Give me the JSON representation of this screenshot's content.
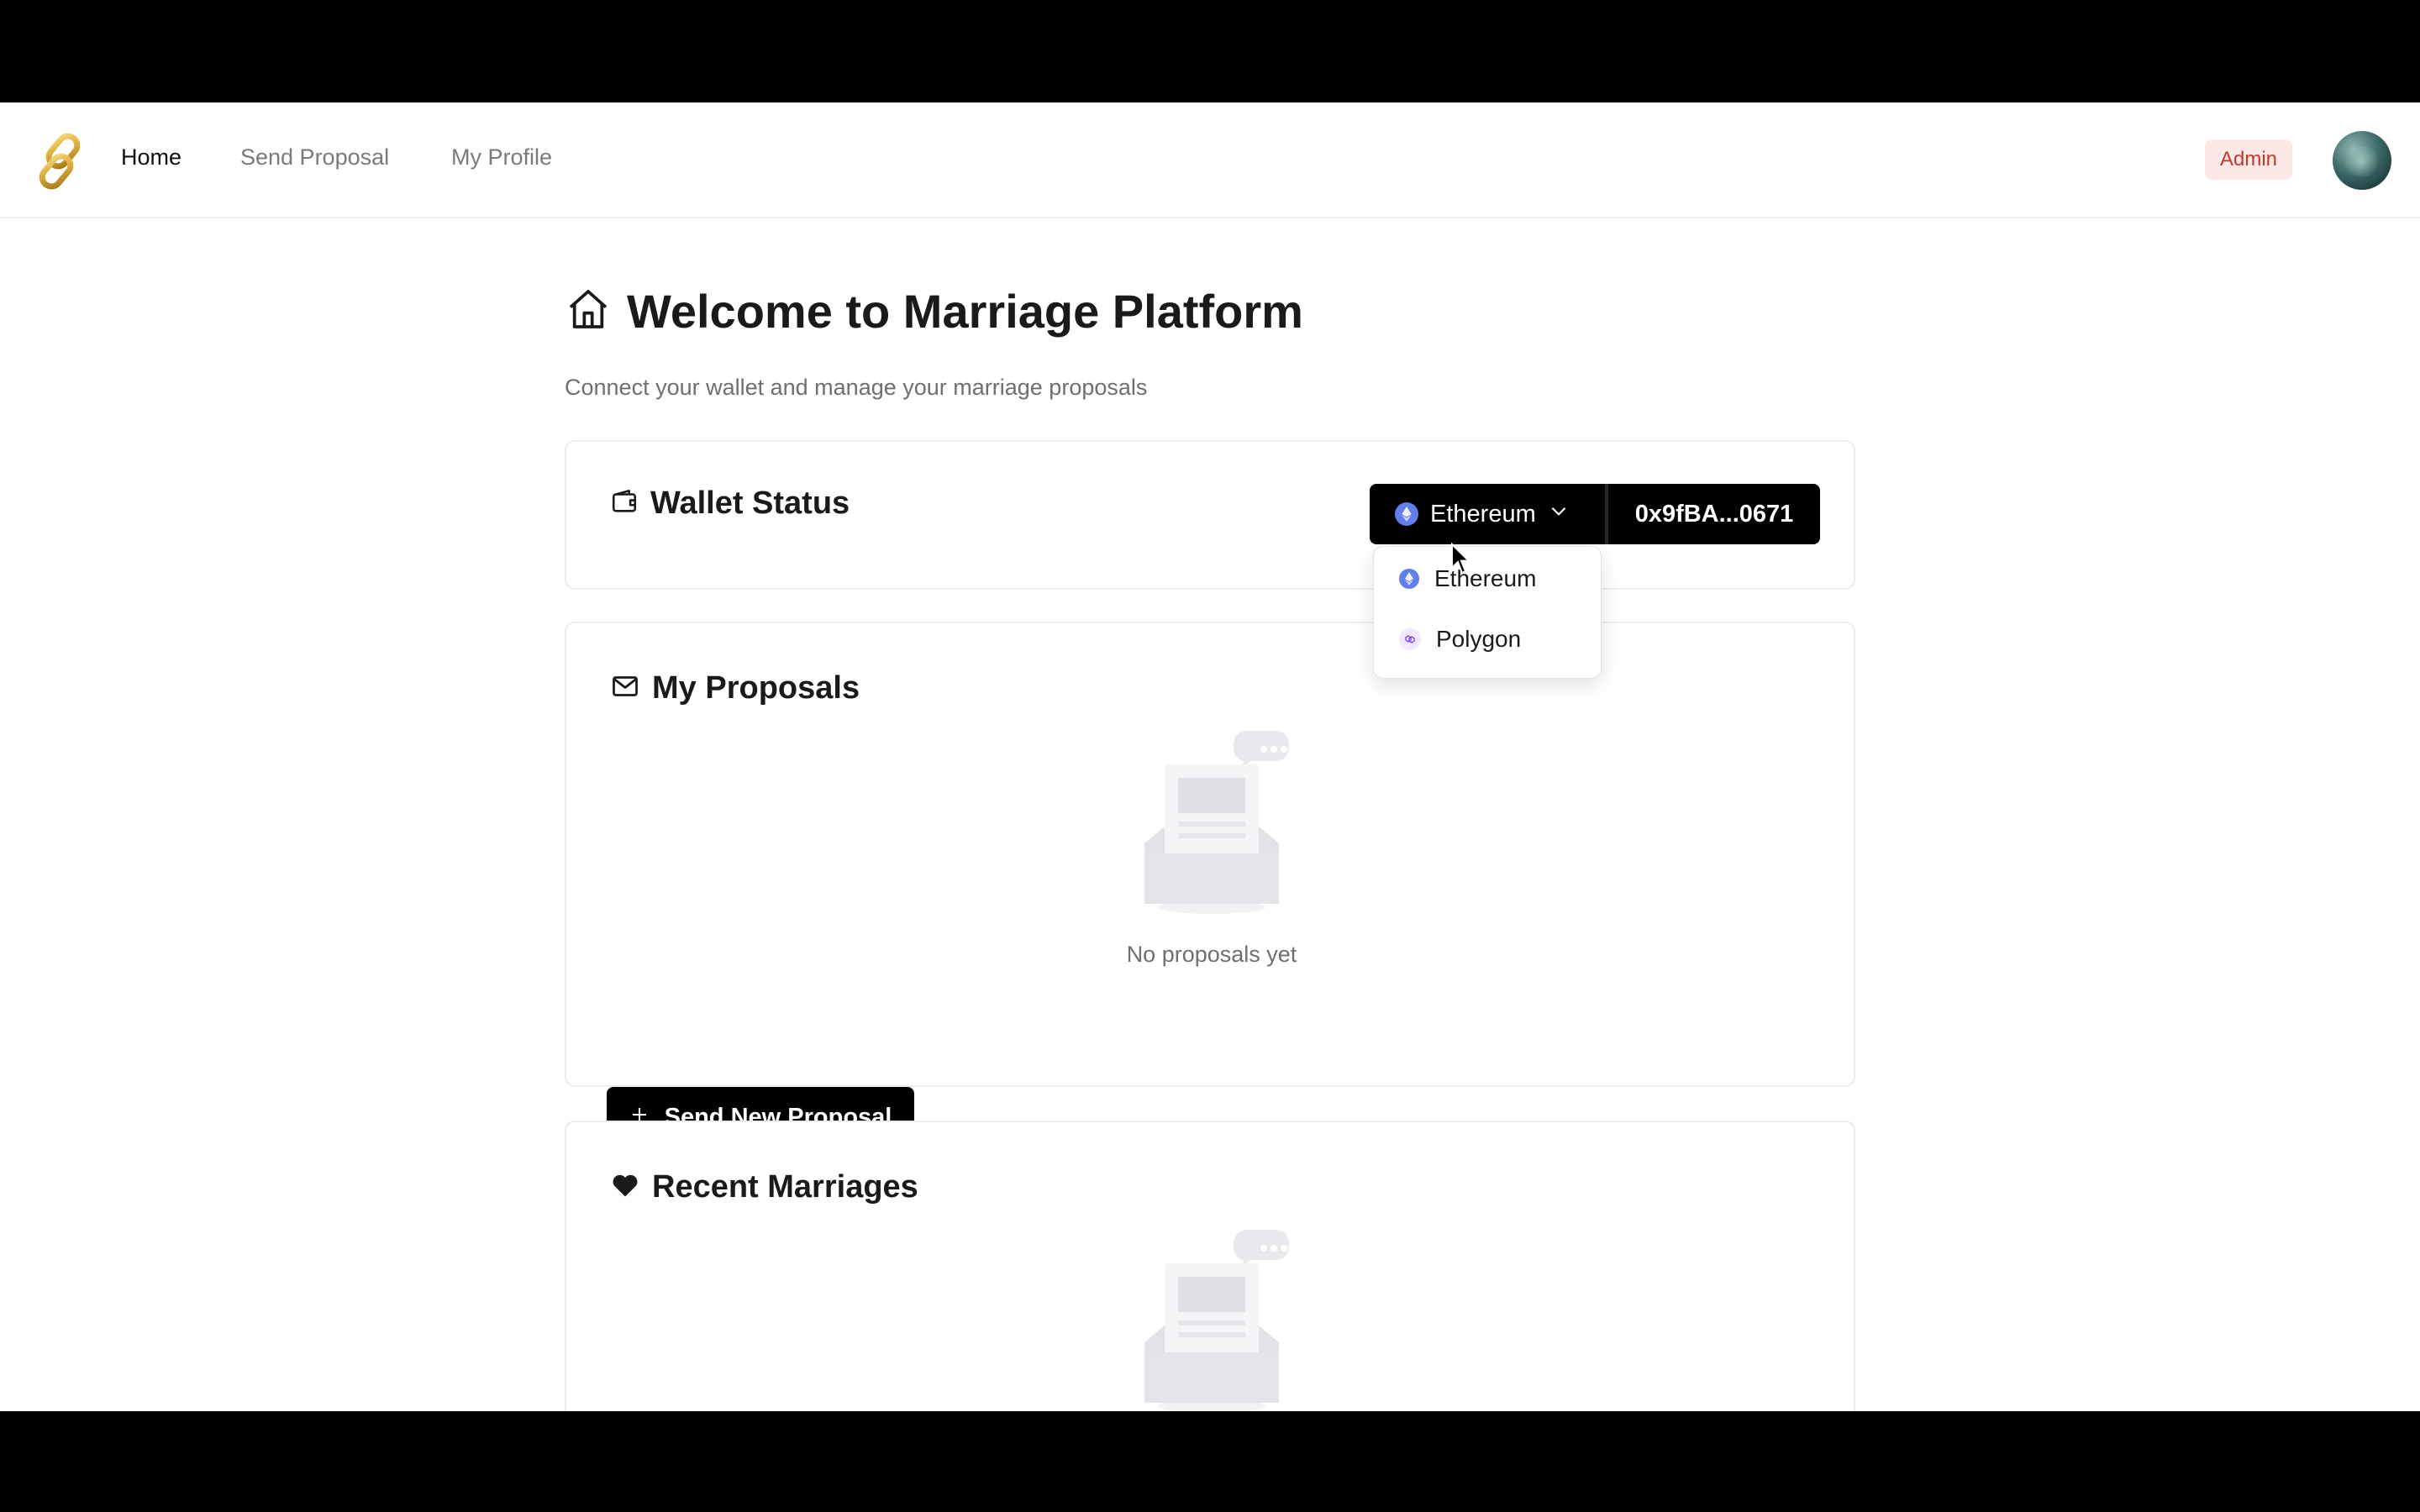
{
  "nav": {
    "links": [
      {
        "label": "Home",
        "active": true
      },
      {
        "label": "Send Proposal",
        "active": false
      },
      {
        "label": "My Profile",
        "active": false
      }
    ],
    "admin_badge": "Admin",
    "logo_icon": "chain-link-icon"
  },
  "page": {
    "title": "Welcome to Marriage Platform",
    "subtitle": "Connect your wallet and manage your marriage proposals",
    "title_icon": "home-icon"
  },
  "wallet": {
    "title": "Wallet Status",
    "network": "Ethereum",
    "address": "0x9fBA...0671",
    "dropdown": [
      "Ethereum",
      "Polygon"
    ]
  },
  "proposals": {
    "title": "My Proposals",
    "empty_text": "No proposals yet",
    "send_button": "Send New Proposal"
  },
  "marriages": {
    "title": "Recent Marriages"
  },
  "colors": {
    "accent": "#000000",
    "ethereum": "#627eea",
    "polygon": "#8247e5",
    "admin_bg": "#fde8e8",
    "admin_text": "#c0392b"
  }
}
